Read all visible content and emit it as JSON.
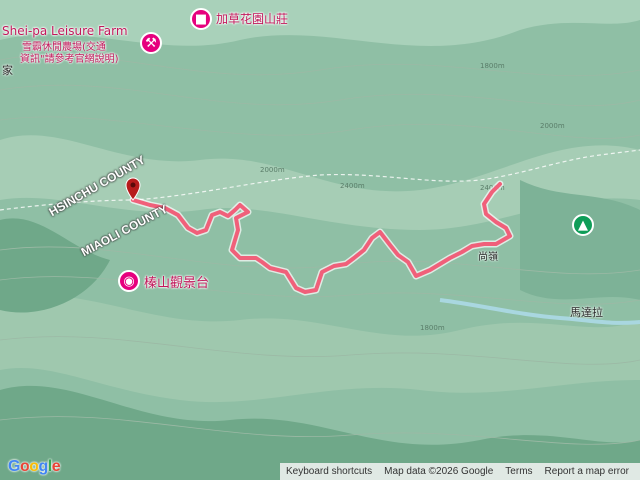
{
  "map": {
    "colors": {
      "terrain_base": "#8fbfa5",
      "terrain_light": "#b9dcc8",
      "terrain_dark": "#5f9c7c",
      "contour": "#9cb9a5",
      "track": "#f0607a",
      "track_outline": "#ffffff",
      "pin": "#b71c1c",
      "poi_pink": "#e6007e",
      "poi_green": "#0f9d58",
      "river": "#a9d7e0"
    },
    "pois": {
      "farm_label_en": "Shei-pa Leisure Farm",
      "farm_label_zh": "雪霸休閒農場(交通",
      "farm_label_zh2": "資訊\"請參考官網說明)",
      "villa_label": "加草花園山莊",
      "viewpoint_label": "榛山觀景台",
      "peak_label": "馬達拉",
      "summit_label": "尚嶺",
      "edge_label": "家"
    },
    "counties": {
      "hsinchu": "HSINCHU COUNTY",
      "miaoli": "MIAOLI COUNTY"
    },
    "contours": [
      "1800m",
      "2000m",
      "2200m",
      "2400m",
      "2000m",
      "2200m",
      "2400m",
      "1800m",
      "2000m",
      "2200m"
    ],
    "icons": [
      "hotel-icon",
      "camera-icon",
      "tree-icon",
      "location-pin-icon",
      "hiking-icon"
    ]
  },
  "footer": {
    "logo": "Google",
    "shortcuts": "Keyboard shortcuts",
    "mapdata": "Map data ©2026 Google",
    "terms": "Terms",
    "report": "Report a map error"
  }
}
